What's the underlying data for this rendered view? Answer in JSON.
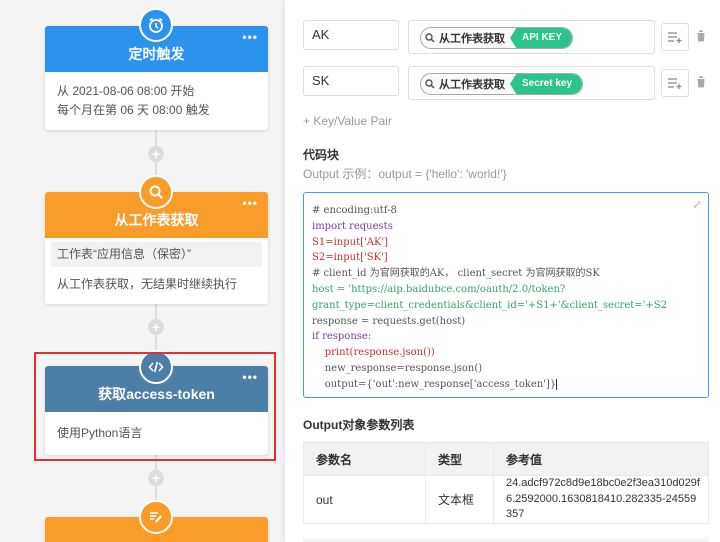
{
  "flow": {
    "node1": {
      "title": "定时触发",
      "dots": "•••",
      "line1": "从 2021-08-06 08:00 开始",
      "line2": "每个月在第 06 天 08:00 触发",
      "color": "#2b93ee",
      "icon": "alarm-clock-icon"
    },
    "node2": {
      "title": "从工作表获取",
      "dots": "•••",
      "sheet": "工作表“应用信息（保密）”",
      "line": "从工作表获取，无结果时继续执行",
      "color": "#fa9c2a",
      "icon": "search-icon"
    },
    "node3": {
      "title": "获取access-token",
      "dots": "•••",
      "line": "使用Python语言",
      "color": "#4b7fa8",
      "icon": "code-icon"
    },
    "node4": {
      "color": "#fa9c2a",
      "icon": "edit-icon"
    },
    "plus": "+"
  },
  "panel": {
    "pairs": [
      {
        "key": "AK",
        "source": "从工作表获取",
        "tag": "API KEY"
      },
      {
        "key": "SK",
        "source": "从工作表获取",
        "tag": "Secret key"
      }
    ],
    "add_pair": "+ Key/Value Pair",
    "code_title": "代码块",
    "hint": "Output 示例：output = {'hello': 'world!'}",
    "code_lines": [
      "# encoding:utf-8",
      "import requests",
      "S1=input['AK']",
      "S2=input['SK']",
      "# client_id 为官网获取的AK， client_secret 为官网获取的SK",
      "host = 'https://aip.baidubce.com/oauth/2.0/token?",
      "grant_type=client_credentials&client_id='+S1+'&client_secret='+S2",
      "response = requests.get(host)",
      "if response:",
      "    print(response.json())",
      "    new_response=response.json()",
      "    output={'out':new_response['access_token']}"
    ],
    "output_title": "Output对象参数列表",
    "table": {
      "headers": [
        "参数名",
        "类型",
        "参考值"
      ],
      "row": {
        "name": "out",
        "type": "文本框",
        "ref": "24.adcf972c8d9e18bc0e2f3ea310d029f6.2592000.1630818410.282335-24559357"
      }
    },
    "accent": "#2bc48d"
  }
}
